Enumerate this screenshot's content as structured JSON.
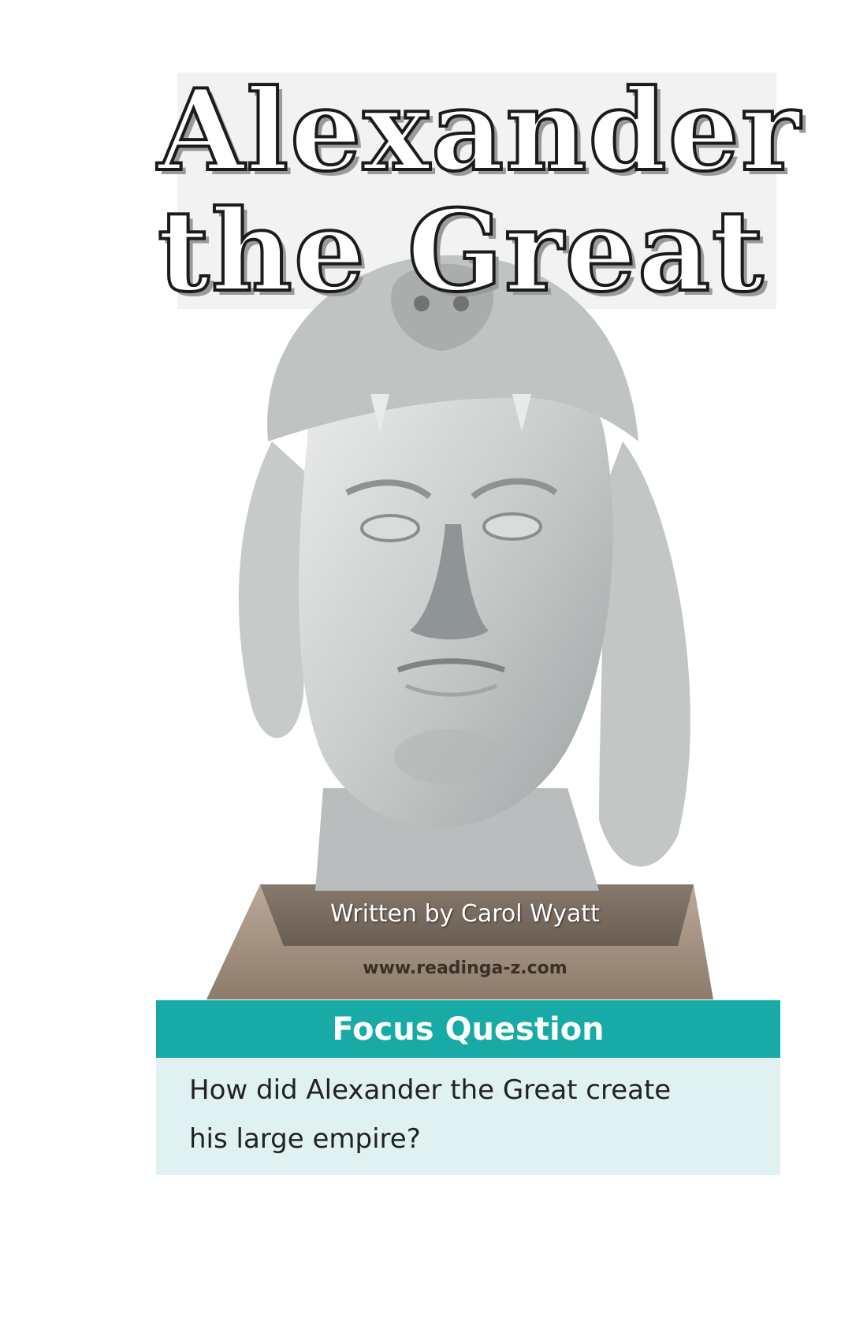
{
  "cover": {
    "title_line_1": "Alexander",
    "title_line_2": "the Great",
    "author": "Written by Carol Wyatt",
    "website": "www.readinga-z.com"
  },
  "focus": {
    "heading": "Focus Question",
    "question": "How did Alexander the Great create his large empire?"
  },
  "colors": {
    "focus_header": "#17aaa6",
    "focus_body": "#dff1f0"
  },
  "image": {
    "subject": "marble-bust-icon"
  }
}
